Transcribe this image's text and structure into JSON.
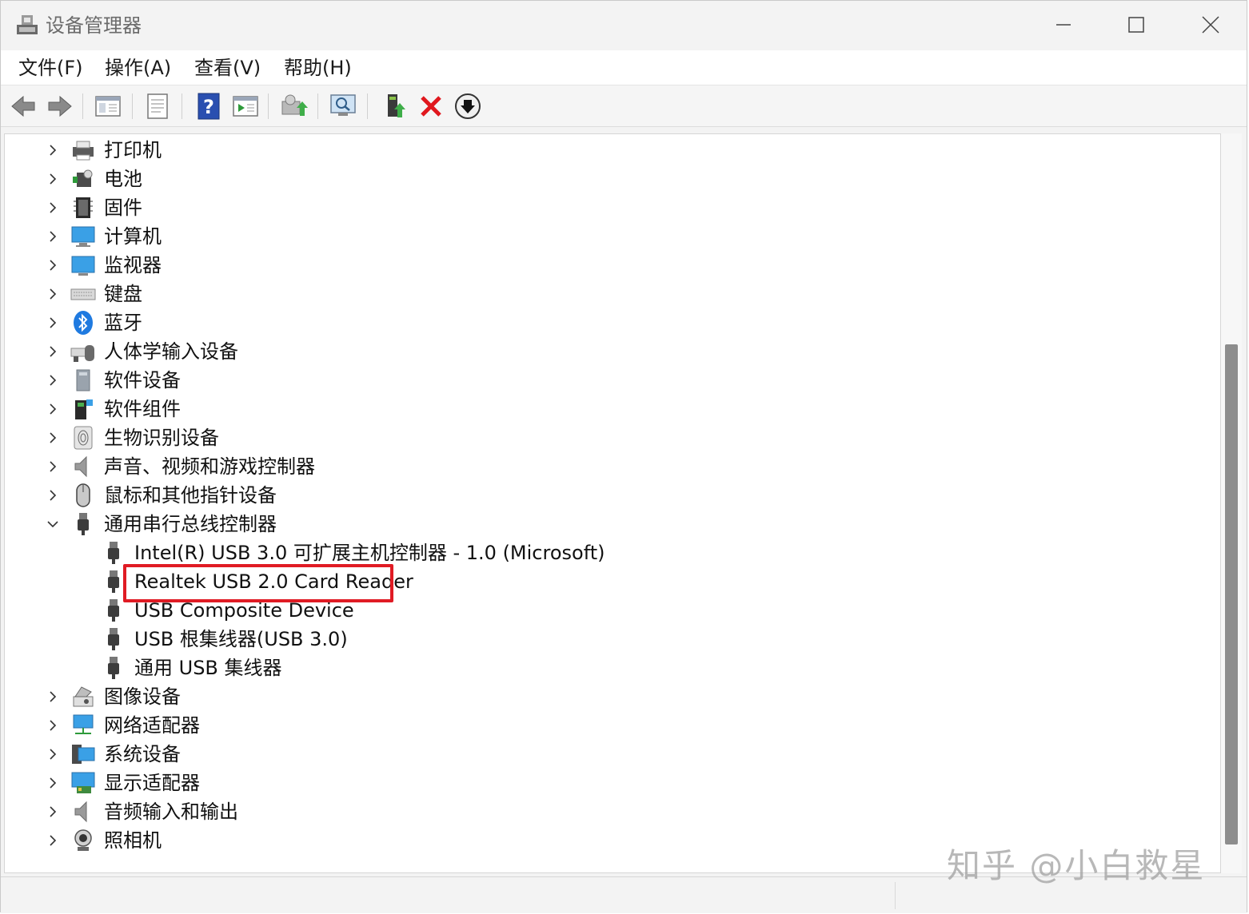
{
  "window": {
    "title": "设备管理器"
  },
  "menu": [
    {
      "label": "文件(F)"
    },
    {
      "label": "操作(A)"
    },
    {
      "label": "查看(V)"
    },
    {
      "label": "帮助(H)"
    }
  ],
  "toolbar": {
    "buttons": [
      "back-icon",
      "forward-icon",
      "show-hide-tree-icon",
      "properties-icon",
      "help-icon",
      "action-pane-icon",
      "update-driver-icon",
      "scan-hardware-icon",
      "enable-device-icon",
      "uninstall-icon",
      "download-driver-icon"
    ]
  },
  "tree": {
    "categories": [
      {
        "label": "打印机",
        "icon": "printer-icon"
      },
      {
        "label": "电池",
        "icon": "battery-icon"
      },
      {
        "label": "固件",
        "icon": "firmware-icon"
      },
      {
        "label": "计算机",
        "icon": "computer-icon"
      },
      {
        "label": "监视器",
        "icon": "monitor-icon"
      },
      {
        "label": "键盘",
        "icon": "keyboard-icon"
      },
      {
        "label": "蓝牙",
        "icon": "bluetooth-icon"
      },
      {
        "label": "人体学输入设备",
        "icon": "hid-icon"
      },
      {
        "label": "软件设备",
        "icon": "software-device-icon"
      },
      {
        "label": "软件组件",
        "icon": "software-component-icon"
      },
      {
        "label": "生物识别设备",
        "icon": "fingerprint-icon"
      },
      {
        "label": "声音、视频和游戏控制器",
        "icon": "speaker-icon"
      },
      {
        "label": "鼠标和其他指针设备",
        "icon": "mouse-icon"
      },
      {
        "label": "通用串行总线控制器",
        "icon": "usb-icon",
        "expanded": true
      }
    ],
    "usb_children": [
      {
        "label": "Intel(R) USB 3.0 可扩展主机控制器 - 1.0 (Microsoft)"
      },
      {
        "label": "Realtek USB 2.0 Card Reader",
        "highlighted": true
      },
      {
        "label": "USB Composite Device"
      },
      {
        "label": "USB 根集线器(USB 3.0)"
      },
      {
        "label": "通用 USB 集线器"
      }
    ],
    "categories_after": [
      {
        "label": "图像设备",
        "icon": "imaging-icon"
      },
      {
        "label": "网络适配器",
        "icon": "network-adapter-icon"
      },
      {
        "label": "系统设备",
        "icon": "system-device-icon"
      },
      {
        "label": "显示适配器",
        "icon": "display-adapter-icon"
      },
      {
        "label": "音频输入和输出",
        "icon": "audio-io-icon"
      },
      {
        "label": "照相机",
        "icon": "camera-icon"
      }
    ]
  },
  "watermark": "知乎 @小白救星",
  "colors": {
    "highlight": "#e01b24",
    "scroll_thumb": "#8d8d8d"
  }
}
